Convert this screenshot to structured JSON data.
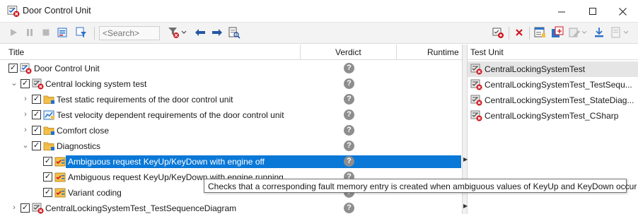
{
  "window": {
    "title": "Door Control Unit"
  },
  "toolbar": {
    "search": {
      "placeholder": "<Search>"
    }
  },
  "left": {
    "columns": {
      "title": "Title",
      "verdict": "Verdict",
      "runtime": "Runtime"
    },
    "rows": [
      {
        "label": "Door Control Unit",
        "verdict": "?"
      },
      {
        "label": "Central locking system test",
        "verdict": "?"
      },
      {
        "label": "Test static requirements of the door control unit",
        "verdict": "?"
      },
      {
        "label": "Test velocity dependent requirements of the door control unit",
        "verdict": "?"
      },
      {
        "label": "Comfort close",
        "verdict": "?"
      },
      {
        "label": "Diagnostics",
        "verdict": "?"
      },
      {
        "label": "Ambiguous request KeyUp/KeyDown with engine off",
        "verdict": "?"
      },
      {
        "label": "Ambiguous request KeyUp/KeyDown with engine running",
        "verdict": "?"
      },
      {
        "label": "Variant coding",
        "verdict": "?"
      },
      {
        "label": "CentralLockingSystemTest_TestSequenceDiagram",
        "verdict": "?"
      }
    ]
  },
  "right": {
    "header": "Test Unit",
    "units": [
      {
        "label": "CentralLockingSystemTest"
      },
      {
        "label": "CentralLockingSystemTest_TestSequ..."
      },
      {
        "label": "CentralLockingSystemTest_StateDiag..."
      },
      {
        "label": "CentralLockingSystemTest_CSharp"
      }
    ]
  },
  "tooltip": {
    "text": "Checks that a corresponding fault memory entry is created when ambiguous values of KeyUp and KeyDown occur"
  },
  "colors": {
    "selection": "#0a78d7",
    "verdict_unknown": "#8e8e8e",
    "accent_blue": "#1f6fd1",
    "error_red": "#d0121b",
    "folder_yellow": "#f2c04b"
  }
}
